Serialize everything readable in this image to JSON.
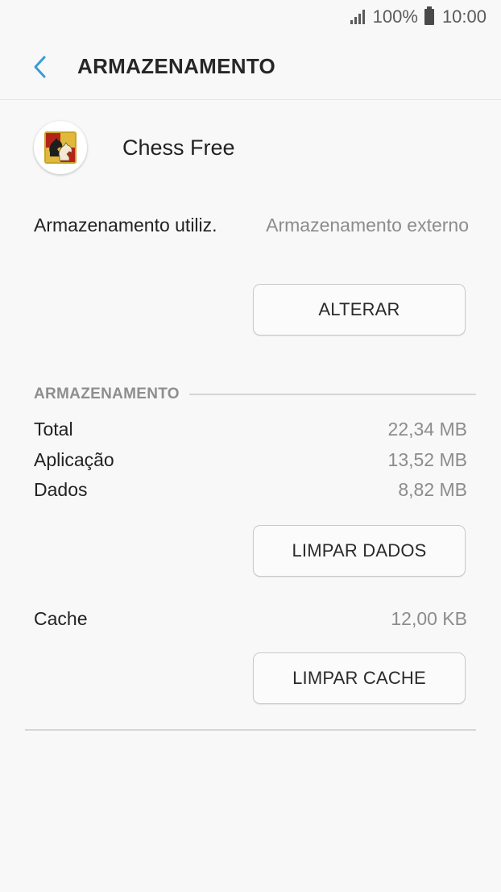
{
  "status_bar": {
    "battery": "100%",
    "time": "10:00"
  },
  "header": {
    "title": "ARMAZENAMENTO",
    "back_icon": "chevron-left-icon",
    "back_color": "#3c9bd4"
  },
  "app": {
    "name": "Chess Free",
    "icon": "chess-knight-icon"
  },
  "storage_used": {
    "label": "Armazenamento utiliz.",
    "value": "Armazenamento externo",
    "change_button": "ALTERAR"
  },
  "storage_section": {
    "title": "ARMAZENAMENTO",
    "rows": [
      {
        "label": "Total",
        "value": "22,34 MB"
      },
      {
        "label": "Aplicação",
        "value": "13,52 MB"
      },
      {
        "label": "Dados",
        "value": "8,82 MB"
      }
    ],
    "clear_data_button": "LIMPAR DADOS"
  },
  "cache": {
    "label": "Cache",
    "value": "12,00 KB",
    "clear_cache_button": "LIMPAR CACHE"
  }
}
